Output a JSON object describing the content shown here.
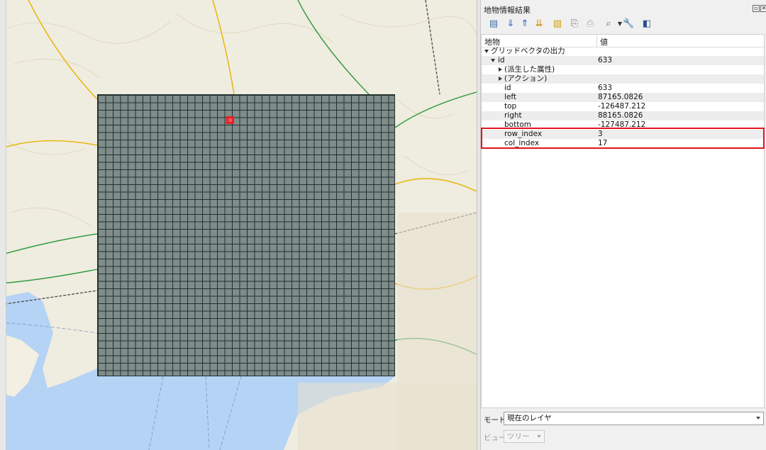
{
  "panel": {
    "title": "地物情報結果",
    "toolbar_icons": [
      "expand-tree-icon",
      "collapse-all-icon",
      "expand-all-icon",
      "expand-new-icon",
      "clear-results-icon",
      "copy-feature-icon",
      "print-icon",
      "identify-select-icon",
      "dropdown-icon",
      "settings-wrench-icon",
      "help-icon"
    ],
    "columns": {
      "feature": "地物",
      "value": "値"
    },
    "tree": {
      "layer": "グリッドベクタの出力",
      "feature_key": "id",
      "feature_value": "633",
      "derived": "(派生した属性)",
      "actions": "(アクション)",
      "attributes": [
        {
          "name": "id",
          "value": "633"
        },
        {
          "name": "left",
          "value": "87165.0826"
        },
        {
          "name": "top",
          "value": "-126487.212"
        },
        {
          "name": "right",
          "value": "88165.0826"
        },
        {
          "name": "bottom",
          "value": "-127487.212"
        },
        {
          "name": "row_index",
          "value": "3"
        },
        {
          "name": "col_index",
          "value": "17"
        }
      ]
    },
    "mode_label": "モード",
    "mode_value": "現在のレイヤ",
    "view_label": "ビュー",
    "view_value": "ツリー"
  },
  "map": {
    "grid_color": "#7e8c8a",
    "selected_color": "#e8202a",
    "sea_color": "#b4d3f5",
    "highlight_color": "#e3141c"
  }
}
